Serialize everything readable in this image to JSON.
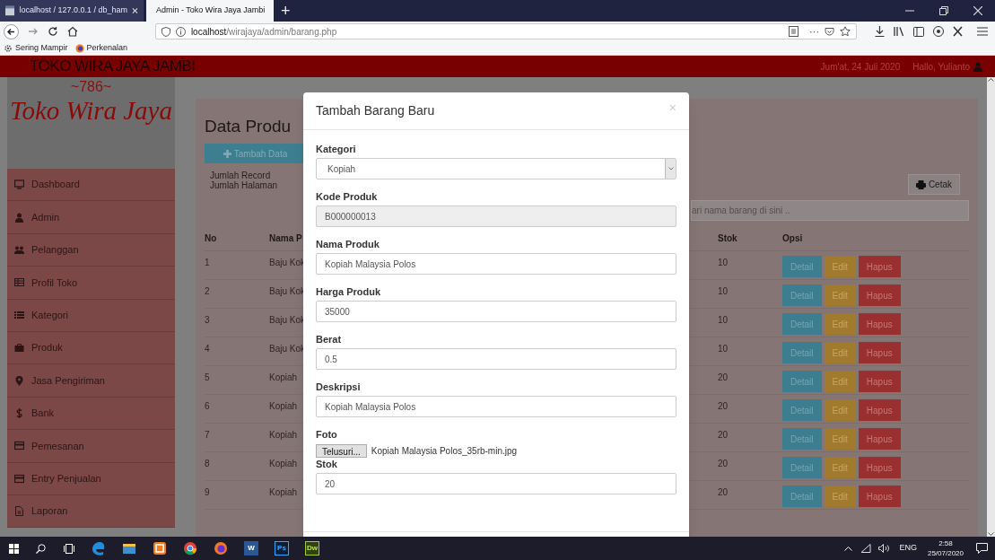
{
  "browser": {
    "tabs": [
      {
        "title": "localhost / 127.0.0.1 / db_ham",
        "selected": false
      },
      {
        "title": "Admin - Toko Wira Jaya Jambi",
        "selected": true
      }
    ],
    "new_tab": "+",
    "url": {
      "host": "localhost",
      "path": "/wirajaya/admin/barang.php"
    },
    "more": "···",
    "bookmarks": [
      {
        "label": "Sering Mampir",
        "kind": "gear"
      },
      {
        "label": "Perkenalan",
        "kind": "globe"
      }
    ]
  },
  "header": {
    "brand": "TOKO WIRA JAYA JAMBI",
    "date": "Jum'at, 24 Juli 2020",
    "user": "Hallo, Yulianto"
  },
  "sidebar": {
    "tagline": "~786~",
    "logo": "Toko Wira Jaya",
    "items": [
      {
        "label": "Dashboard",
        "kind": "monitor"
      },
      {
        "label": "Admin",
        "kind": "user"
      },
      {
        "label": "Pelanggan",
        "kind": "users"
      },
      {
        "label": "Profil Toko",
        "kind": "table"
      },
      {
        "label": "Kategori",
        "kind": "list"
      },
      {
        "label": "Produk",
        "kind": "briefcase"
      },
      {
        "label": "Jasa Pengiriman",
        "kind": "pin"
      },
      {
        "label": "Bank",
        "kind": "dollar"
      },
      {
        "label": "Pemesanan",
        "kind": "card"
      },
      {
        "label": "Entry Penjualan",
        "kind": "card"
      },
      {
        "label": "Laporan",
        "kind": "file"
      }
    ]
  },
  "content": {
    "title": "Data Produ",
    "add_button": "Tambah Data",
    "stats": [
      "Jumlah Record",
      "Jumlah Halaman"
    ],
    "print_button": "Cetak",
    "search": {
      "placeholder": "ari nama barang di sini .."
    },
    "table": {
      "columns": [
        "No",
        "Nama P",
        "Stok",
        "Opsi"
      ],
      "rows": [
        {
          "no": "1",
          "name": "Baju Kok",
          "stok": "10",
          "actions": [
            {
              "label": "Detail",
              "kind": "info"
            },
            {
              "label": "Edit",
              "kind": "warning"
            },
            {
              "label": "Hapus",
              "kind": "danger"
            }
          ]
        },
        {
          "no": "2",
          "name": "Baju Kok",
          "stok": "10",
          "actions": [
            {
              "label": "Detail",
              "kind": "info"
            },
            {
              "label": "Edit",
              "kind": "warning"
            },
            {
              "label": "Hapus",
              "kind": "danger"
            }
          ]
        },
        {
          "no": "3",
          "name": "Baju Kok",
          "stok": "10",
          "actions": [
            {
              "label": "Detail",
              "kind": "info"
            },
            {
              "label": "Edit",
              "kind": "warning"
            },
            {
              "label": "Hapus",
              "kind": "danger"
            }
          ]
        },
        {
          "no": "4",
          "name": "Baju Kok",
          "stok": "10",
          "actions": [
            {
              "label": "Detail",
              "kind": "info"
            },
            {
              "label": "Edit",
              "kind": "warning"
            },
            {
              "label": "Hapus",
              "kind": "danger"
            }
          ]
        },
        {
          "no": "5",
          "name": "Kopiah",
          "stok": "20",
          "actions": [
            {
              "label": "Detail",
              "kind": "info"
            },
            {
              "label": "Edit",
              "kind": "warning"
            },
            {
              "label": "Hapus",
              "kind": "danger"
            }
          ]
        },
        {
          "no": "6",
          "name": "Kopiah",
          "stok": "20",
          "actions": [
            {
              "label": "Detail",
              "kind": "info"
            },
            {
              "label": "Edit",
              "kind": "warning"
            },
            {
              "label": "Hapus",
              "kind": "danger"
            }
          ]
        },
        {
          "no": "7",
          "name": "Kopiah",
          "stok": "20",
          "actions": [
            {
              "label": "Detail",
              "kind": "info"
            },
            {
              "label": "Edit",
              "kind": "warning"
            },
            {
              "label": "Hapus",
              "kind": "danger"
            }
          ]
        },
        {
          "no": "8",
          "name": "Kopiah",
          "stok": "20",
          "actions": [
            {
              "label": "Detail",
              "kind": "info"
            },
            {
              "label": "Edit",
              "kind": "warning"
            },
            {
              "label": "Hapus",
              "kind": "danger"
            }
          ]
        },
        {
          "no": "9",
          "name": "Kopiah",
          "stok": "20",
          "actions": [
            {
              "label": "Detail",
              "kind": "info"
            },
            {
              "label": "Edit",
              "kind": "warning"
            },
            {
              "label": "Hapus",
              "kind": "danger"
            }
          ]
        }
      ]
    }
  },
  "modal": {
    "title": "Tambah Barang Baru",
    "close": "×",
    "fields": [
      {
        "label": "Kategori",
        "kind": "select",
        "value": "Kopiah"
      },
      {
        "label": "Kode Produk",
        "kind": "input",
        "value": "B000000013",
        "disabled": true
      },
      {
        "label": "Nama Produk",
        "kind": "input",
        "value": "Kopiah Malaysia Polos",
        "disabled": false
      },
      {
        "label": "Harga Produk",
        "kind": "input",
        "value": "35000",
        "disabled": false
      },
      {
        "label": "Berat",
        "kind": "input",
        "value": "0.5",
        "disabled": false
      },
      {
        "label": "Deskripsi",
        "kind": "input",
        "value": "Kopiah Malaysia Polos",
        "disabled": false
      },
      {
        "label": "Foto",
        "kind": "file",
        "button": "Telusuri...",
        "value": "Kopiah Malaysia Polos_35rb-min.jpg"
      },
      {
        "label": "Stok",
        "kind": "input",
        "value": "20",
        "disabled": false
      }
    ]
  },
  "taskbar": {
    "apps": [
      {
        "kind": "edge"
      },
      {
        "kind": "folder"
      },
      {
        "kind": "xampp"
      },
      {
        "kind": "chrome"
      },
      {
        "kind": "firefox"
      },
      {
        "kind": "word",
        "label": "W"
      },
      {
        "kind": "ps",
        "label": "Ps"
      },
      {
        "kind": "dw",
        "label": "Dw"
      }
    ],
    "language": "ENG",
    "time": "2:58",
    "date": "25/07/2020"
  }
}
